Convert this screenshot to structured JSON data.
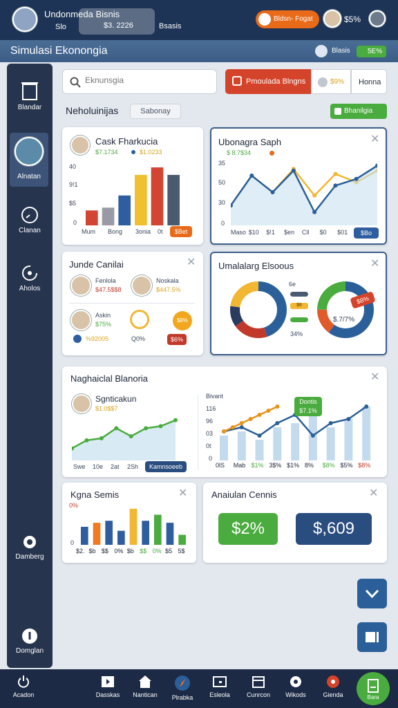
{
  "top": {
    "user_name": "Undonmeda Bisnis",
    "meta1": "Slo",
    "meta2": "$3. 2226",
    "meta3": "Bsasis",
    "action_label": "Bldsn- Fogat",
    "percent": "$5%"
  },
  "sub": {
    "title": "Simulasi Ekonongia",
    "right1": "Blasis",
    "right2": "5E%"
  },
  "sidebar": [
    {
      "label": "Blandar"
    },
    {
      "label": "Alnatan"
    },
    {
      "label": "Clanan"
    },
    {
      "label": "Aholos"
    },
    {
      "label": "Damberg"
    },
    {
      "label": "Domglan"
    }
  ],
  "search": {
    "placeholder": "Eknunsgia"
  },
  "header_tabs": {
    "primary": "Pmoulada Blngns",
    "pct": "$9%",
    "secondary": "Honna"
  },
  "heading": {
    "title": "Neholuinijas",
    "chip": "Sabonay",
    "action": "Bhanilgia"
  },
  "card1": {
    "title": "Cask Fharkucia",
    "val1": "$7.1734",
    "val2": "$1.0233",
    "ylabels": [
      "40",
      "9!1",
      "$5",
      "0"
    ],
    "xlabels": [
      "Mum",
      "Bong",
      "3onia",
      "0t"
    ],
    "badge": "$Bet",
    "colors": [
      "#d24533",
      "#9a9aa6",
      "#2f5ea0",
      "#f0c030",
      "#d24533",
      "#4a5a70"
    ],
    "values": [
      8,
      9.5,
      16,
      27,
      31,
      27
    ]
  },
  "card2": {
    "title": "Ubonagra Saph",
    "val1": "$ 8.7$34",
    "ylabels": [
      "35",
      "50",
      "30",
      "0"
    ],
    "xlabels": [
      "Maso",
      "$10",
      "$!1",
      "$en",
      "Cll",
      "$0",
      "$01"
    ],
    "badge": "$Bo",
    "blue": [
      12,
      30,
      20,
      33,
      8,
      24,
      28,
      36
    ],
    "gold": [
      12,
      30,
      20,
      34,
      18,
      31,
      26,
      33
    ]
  },
  "card3": {
    "title": "Junde Canilai",
    "p1_name": "Fenlola",
    "p1_val": "$47.5$$8",
    "p2_name": "Noskala",
    "p2_val": "$447.5%",
    "p3_name": "Askin",
    "p3_val": "$75%",
    "p3_sub": "%92005",
    "p4_val": "Q0%",
    "p5_val": "$8%",
    "p6_val": "$6%"
  },
  "card4": {
    "title": "Umalalarg Elsoous",
    "legend": [
      "6e",
      "$8",
      "",
      "34%"
    ],
    "right_badge": "$8%",
    "right_val": "$.7/7%",
    "donut1": [
      {
        "v": 45,
        "c": "#2a5f99"
      },
      {
        "v": 20,
        "c": "#c0392b"
      },
      {
        "v": 12,
        "c": "#2a3b60"
      },
      {
        "v": 23,
        "c": "#f2b732"
      }
    ],
    "donut2": [
      {
        "v": 60,
        "c": "#2a5f99"
      },
      {
        "v": 15,
        "c": "#e05a2a"
      },
      {
        "v": 25,
        "c": "#4aab3e"
      }
    ]
  },
  "card5": {
    "title": "Naghaiclal Blanoria",
    "person": "Sgnticakun",
    "person_val": "$1.0$$7",
    "xlabels": [
      "Swe",
      "10e",
      "2at",
      "2Sh"
    ],
    "btn": "Kamnsoeeb",
    "right_label": "Bivant",
    "ylabels": [
      "116",
      "96",
      "03",
      "0t",
      "0"
    ],
    "tooltip1": "Dontis",
    "tooltip2": "$7.1%",
    "rxlabels": [
      "0lS",
      "Mab",
      "$1%",
      "3$%",
      "$1%",
      "8%",
      "$8%",
      "$5%",
      "$8%"
    ],
    "rxcolors": [
      "#1b2436",
      "#1b2436",
      "#4aab3e",
      "#1b2436",
      "#1b2436",
      "#1b2436",
      "#4aab3e",
      "#1b2436",
      "#c0392b"
    ],
    "left_line": [
      3,
      5,
      5.5,
      8,
      6,
      8,
      8.5,
      10
    ],
    "bars": [
      6,
      7,
      5,
      8,
      9,
      14,
      8,
      10,
      13
    ],
    "blue_line": [
      7,
      8,
      6,
      9,
      11,
      6,
      9,
      10,
      13
    ],
    "orange_line": [
      7,
      8,
      9,
      10,
      11,
      12,
      13
    ]
  },
  "card6": {
    "title": "Kgna Semis",
    "pct": "0%",
    "xlabels": [
      "$2.",
      "$b",
      "$$",
      "0%",
      "$b",
      "$$",
      "0%",
      "$5",
      "5$"
    ],
    "xcolors": [
      "#1b2436",
      "#1b2436",
      "#1b2436",
      "#1b2436",
      "#1b2436",
      "#4aab3e",
      "#4aab3e",
      "#1b2436",
      "#1b2436"
    ],
    "bar_values": [
      9,
      11,
      12,
      7,
      18,
      12,
      15,
      11,
      5
    ],
    "bar_colors": [
      "#2f5ea0",
      "#f07a20",
      "#2f5ea0",
      "#2f5ea0",
      "#f2b732",
      "#2f5ea0",
      "#4aab3e",
      "#2f5ea0",
      "#4aab3e"
    ]
  },
  "card7": {
    "title": "Anaiulan Cennis",
    "tile1": "$2%",
    "tile2": "$,609"
  },
  "bottom": [
    {
      "label": "Acadon"
    },
    {
      "label": "Dasskas"
    },
    {
      "label": "Nantican"
    },
    {
      "label": "Plrabka"
    },
    {
      "label": "Esleola"
    },
    {
      "label": "Cunrcon"
    },
    {
      "label": "Wikods"
    },
    {
      "label": "Gienda"
    },
    {
      "label": "Bara"
    }
  ]
}
